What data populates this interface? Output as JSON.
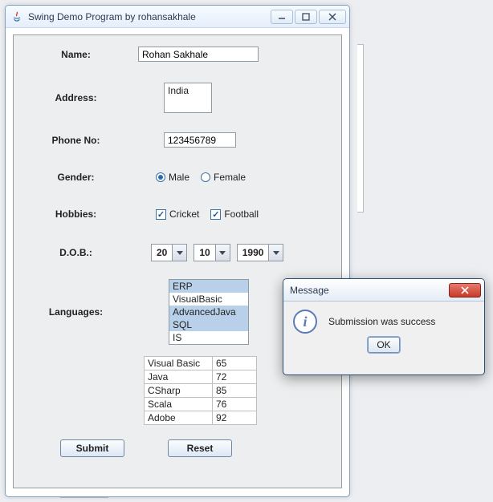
{
  "window": {
    "title": "Swing Demo Program by rohansakhale"
  },
  "form": {
    "name_label": "Name:",
    "name_value": "Rohan Sakhale",
    "address_label": "Address:",
    "address_value": "India",
    "phone_label": "Phone No:",
    "phone_value": "123456789",
    "gender_label": "Gender:",
    "gender_male": "Male",
    "gender_female": "Female",
    "gender_selected": "Male",
    "hobbies_label": "Hobbies:",
    "hobby_cricket": "Cricket",
    "hobby_football": "Football",
    "hobby_cricket_checked": true,
    "hobby_football_checked": true,
    "dob_label": "D.O.B.:",
    "dob_day": "20",
    "dob_month": "10",
    "dob_year": "1990",
    "languages_label": "Languages:",
    "languages_list": [
      "ERP",
      "VisualBasic",
      "AdvancedJava",
      "SQL",
      "IS"
    ],
    "table": [
      {
        "name": "Visual Basic",
        "score": "65"
      },
      {
        "name": "Java",
        "score": "72"
      },
      {
        "name": "CSharp",
        "score": "85"
      },
      {
        "name": "Scala",
        "score": "76"
      },
      {
        "name": "Adobe",
        "score": "92"
      }
    ],
    "submit_label": "Submit",
    "reset_label": "Reset"
  },
  "dialog": {
    "title": "Message",
    "text": "Submission was success",
    "ok_label": "OK"
  }
}
